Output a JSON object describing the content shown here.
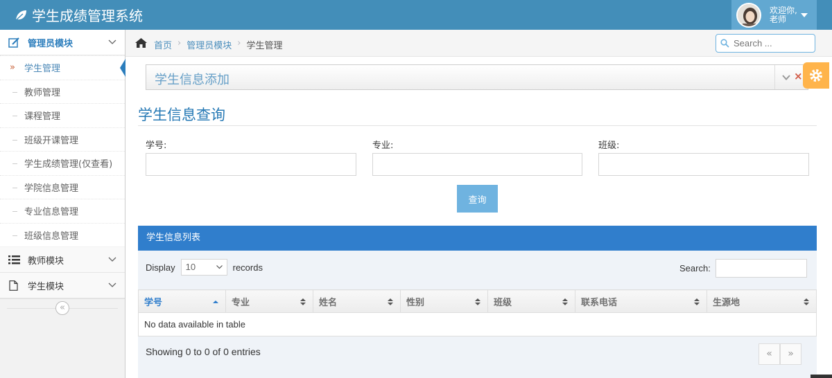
{
  "app": {
    "title": "学生成绩管理系统",
    "brand_icon": "leaf-icon"
  },
  "user": {
    "greeting": "欢迎你,",
    "name": "老师"
  },
  "sidebar": {
    "modules": [
      {
        "label": "管理员模块",
        "icon": "pencil-square-icon",
        "expanded": true,
        "items": [
          {
            "label": "学生管理",
            "active": true
          },
          {
            "label": "教师管理"
          },
          {
            "label": "课程管理"
          },
          {
            "label": "班级开课管理"
          },
          {
            "label": "学生成绩管理(仅查看)"
          },
          {
            "label": "学院信息管理"
          },
          {
            "label": "专业信息管理"
          },
          {
            "label": "班级信息管理"
          }
        ]
      },
      {
        "label": "教师模块",
        "icon": "list-icon"
      },
      {
        "label": "学生模块",
        "icon": "document-icon"
      }
    ],
    "collapse_glyph": "«"
  },
  "breadcrumb": {
    "home": "首页",
    "module": "管理员模块",
    "current": "学生管理",
    "separator": "›"
  },
  "search": {
    "placeholder": "Search ..."
  },
  "add_widget": {
    "title": "学生信息添加",
    "close_glyph": "×"
  },
  "query_section": {
    "title": "学生信息查询",
    "fields": {
      "student_no": "学号:",
      "major": "专业:",
      "class": "班级:"
    },
    "button": "查询"
  },
  "table_panel": {
    "title": "学生信息列表",
    "display_prefix": "Display",
    "display_value": "10",
    "display_suffix": "records",
    "search_label": "Search:",
    "columns": [
      "学号",
      "专业",
      "姓名",
      "性别",
      "班级",
      "联系电话",
      "生源地"
    ],
    "empty_text": "No data available in table",
    "info": "Showing 0 to 0 of 0 entries",
    "pager": {
      "prev": "«",
      "next": "»"
    }
  },
  "colors": {
    "navbar": "#438eb9",
    "accent": "#307ecc",
    "settings": "#ffb44b"
  }
}
